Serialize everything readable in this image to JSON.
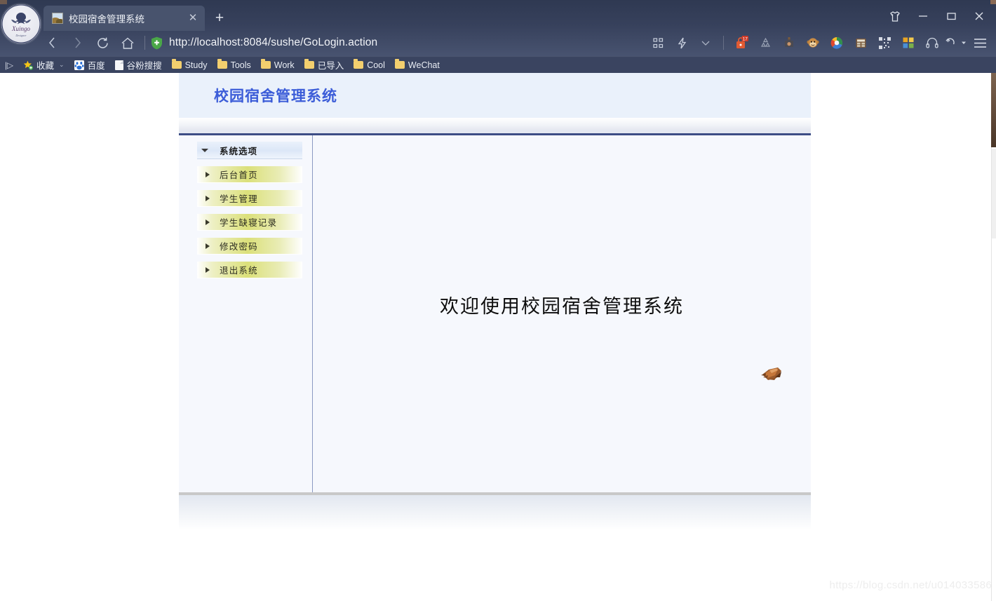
{
  "browser": {
    "logo_text": "Xuingo Designer",
    "tab": {
      "title": "校园宿舍管理系统",
      "close_label": "✕",
      "favicon_name": "image-favicon"
    },
    "new_tab_label": "+",
    "window_controls": {
      "skin_label": "skin",
      "minimize_label": "—",
      "maximize_label": "☐",
      "close_label": "✕"
    },
    "nav": {
      "back_label": "‹",
      "forward_label": "›",
      "reload_label": "↻",
      "home_label": "⌂"
    },
    "address": {
      "url": "http://localhost:8084/sushe/GoLogin.action",
      "security_icon": "green-shield-plus-icon"
    },
    "toolbar_icons": [
      {
        "name": "grid-apps-icon",
        "glyph": "∷"
      },
      {
        "name": "lightning-speed-icon",
        "glyph": "⚡"
      },
      {
        "name": "chevron-down-icon",
        "glyph": "⌄"
      },
      {
        "name": "lock-notifications-icon",
        "glyph": "🔒",
        "badge": "17"
      },
      {
        "name": "recycle-icon",
        "glyph": "♻"
      },
      {
        "name": "camera-screenshot-icon",
        "glyph": "📷"
      },
      {
        "name": "monkey-emoji-icon",
        "glyph": "🐵"
      },
      {
        "name": "color-ring-icon",
        "glyph": "◎"
      },
      {
        "name": "calculator-icon",
        "glyph": "▤"
      },
      {
        "name": "qrcode-icon",
        "glyph": "▒"
      },
      {
        "name": "windows-tiles-icon",
        "glyph": "⊞"
      },
      {
        "name": "headphones-icon",
        "glyph": "♫"
      },
      {
        "name": "undo-history-icon",
        "glyph": "↶"
      },
      {
        "name": "menu-hamburger-icon",
        "glyph": "≡"
      }
    ],
    "bookmarks": {
      "overflow_label": "|▷",
      "items": [
        {
          "label": "收藏",
          "icon": "star-bookmark-icon",
          "caret": "⌄"
        },
        {
          "label": "百度",
          "icon": "baidu-icon"
        },
        {
          "label": "谷粉搜搜",
          "icon": "page-icon"
        },
        {
          "label": "Study",
          "icon": "folder-icon"
        },
        {
          "label": "Tools",
          "icon": "folder-icon"
        },
        {
          "label": "Work",
          "icon": "folder-icon"
        },
        {
          "label": "已导入",
          "icon": "folder-icon"
        },
        {
          "label": "Cool",
          "icon": "folder-icon"
        },
        {
          "label": "WeChat",
          "icon": "folder-icon"
        }
      ]
    }
  },
  "page": {
    "header_title": "校园宿舍管理系统",
    "sidebar": {
      "menu_header": "系统选项",
      "items": [
        {
          "label": "后台首页"
        },
        {
          "label": "学生管理"
        },
        {
          "label": "学生缺寝记录"
        },
        {
          "label": "修改密码"
        },
        {
          "label": "退出系统"
        }
      ]
    },
    "content": {
      "welcome": "欢迎使用校园宿舍管理系统",
      "ornament_name": "brown-bird-ornament"
    },
    "watermark": "https://blog.csdn.net/u014033586"
  },
  "colors": {
    "chrome_bg": "#37415c",
    "bookmarks_bg": "#3a4460",
    "app_header_bg": "#eaf1fb",
    "app_title": "#3b5cd8",
    "topline": "#3c4d85",
    "menu_green": "#dbe07a",
    "page_bg": "#f6f8fd",
    "badge_red": "#d94030"
  }
}
